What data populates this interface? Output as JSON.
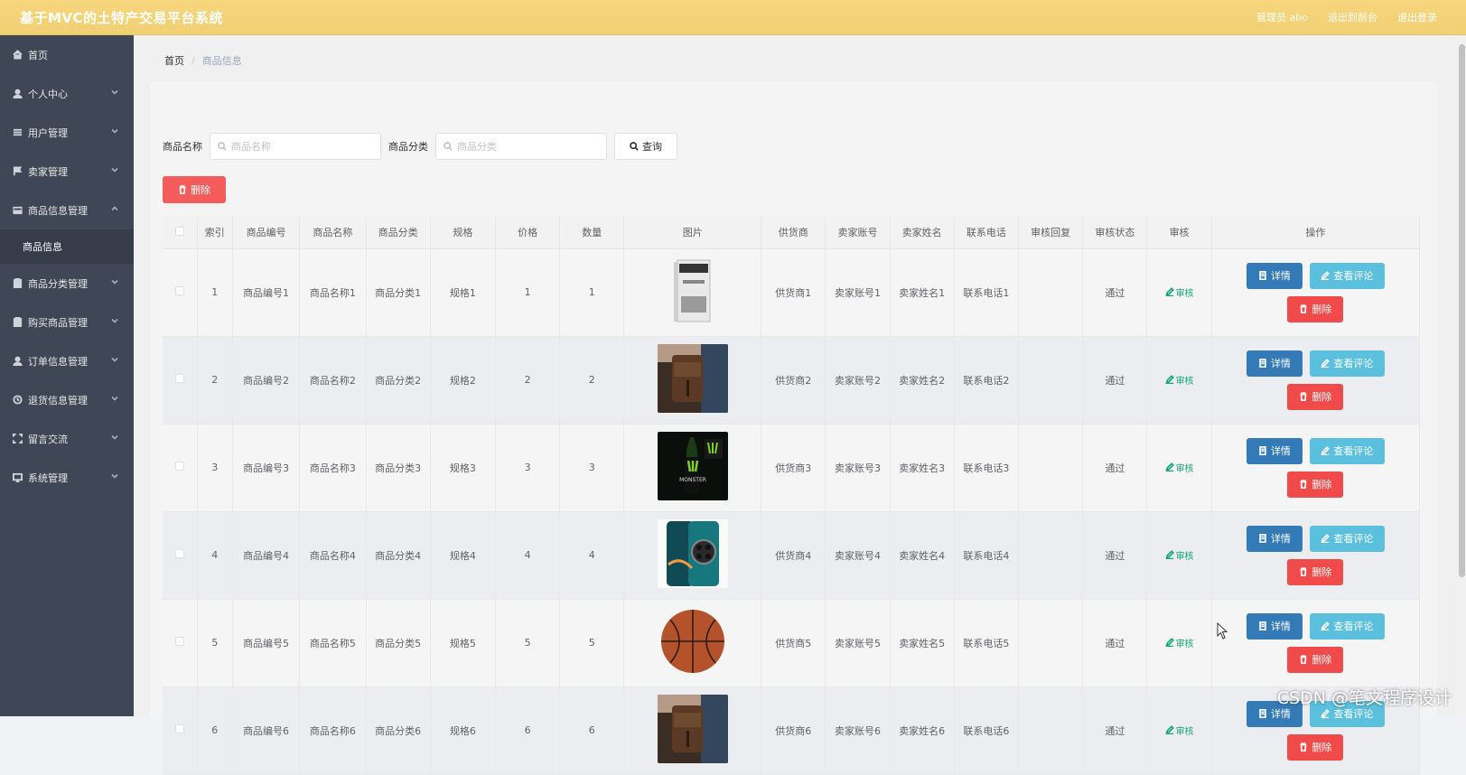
{
  "header": {
    "title": "基于MVC的土特产交易平台系统",
    "admin_label": "管理员 abo",
    "front_link": "退出到前台",
    "logout_link": "退出登录"
  },
  "sidebar": {
    "items": [
      {
        "label": "首页",
        "icon": "home-icon",
        "expandable": false
      },
      {
        "label": "个人中心",
        "icon": "user-icon",
        "expandable": true
      },
      {
        "label": "用户管理",
        "icon": "sliders-icon",
        "expandable": true
      },
      {
        "label": "卖家管理",
        "icon": "flag-icon",
        "expandable": true
      },
      {
        "label": "商品信息管理",
        "icon": "box-icon",
        "expandable": true,
        "expanded": true,
        "children": [
          {
            "label": "商品信息"
          }
        ]
      },
      {
        "label": "商品分类管理",
        "icon": "clipboard-icon",
        "expandable": true
      },
      {
        "label": "购买商品管理",
        "icon": "clipboard-icon",
        "expandable": true
      },
      {
        "label": "订单信息管理",
        "icon": "user-icon",
        "expandable": true
      },
      {
        "label": "退货信息管理",
        "icon": "clock-icon",
        "expandable": true
      },
      {
        "label": "留言交流",
        "icon": "expand-icon",
        "expandable": true
      },
      {
        "label": "系统管理",
        "icon": "monitor-icon",
        "expandable": true
      }
    ]
  },
  "breadcrumb": {
    "home": "首页",
    "current": "商品信息"
  },
  "search": {
    "name_label": "商品名称",
    "name_placeholder": "商品名称",
    "category_label": "商品分类",
    "category_placeholder": "商品分类",
    "query_button": "查询"
  },
  "delete_button": "删除",
  "table": {
    "headers": [
      "索引",
      "商品编号",
      "商品名称",
      "商品分类",
      "规格",
      "价格",
      "数量",
      "图片",
      "供货商",
      "卖家账号",
      "卖家姓名",
      "联系电话",
      "审核回复",
      "审核状态",
      "审核",
      "操作"
    ],
    "rows": [
      {
        "index": "1",
        "code": "商品编号1",
        "name": "商品名称1",
        "category": "商品分类1",
        "spec": "规格1",
        "price": "1",
        "qty": "1",
        "image": "book",
        "supplier": "供货商1",
        "seller_account": "卖家账号1",
        "seller_name": "卖家姓名1",
        "phone": "联系电话1",
        "reply": "",
        "status": "通过",
        "audit": "审核"
      },
      {
        "index": "2",
        "code": "商品编号2",
        "name": "商品名称2",
        "category": "商品分类2",
        "spec": "规格2",
        "price": "2",
        "qty": "2",
        "image": "bag",
        "supplier": "供货商2",
        "seller_account": "卖家账号2",
        "seller_name": "卖家姓名2",
        "phone": "联系电话2",
        "reply": "",
        "status": "通过",
        "audit": "审核"
      },
      {
        "index": "3",
        "code": "商品编号3",
        "name": "商品名称3",
        "category": "商品分类3",
        "spec": "规格3",
        "price": "3",
        "qty": "3",
        "image": "monster",
        "supplier": "供货商3",
        "seller_account": "卖家账号3",
        "seller_name": "卖家姓名3",
        "phone": "联系电话3",
        "reply": "",
        "status": "通过",
        "audit": "审核"
      },
      {
        "index": "4",
        "code": "商品编号4",
        "name": "商品名称4",
        "category": "商品分类4",
        "spec": "规格4",
        "price": "4",
        "qty": "4",
        "image": "phone",
        "supplier": "供货商4",
        "seller_account": "卖家账号4",
        "seller_name": "卖家姓名4",
        "phone": "联系电话4",
        "reply": "",
        "status": "通过",
        "audit": "审核"
      },
      {
        "index": "5",
        "code": "商品编号5",
        "name": "商品名称5",
        "category": "商品分类5",
        "spec": "规格5",
        "price": "5",
        "qty": "5",
        "image": "basketball",
        "supplier": "供货商5",
        "seller_account": "卖家账号5",
        "seller_name": "卖家姓名5",
        "phone": "联系电话5",
        "reply": "",
        "status": "通过",
        "audit": "审核"
      },
      {
        "index": "6",
        "code": "商品编号6",
        "name": "商品名称6",
        "category": "商品分类6",
        "spec": "规格6",
        "price": "6",
        "qty": "6",
        "image": "bag",
        "supplier": "供货商6",
        "seller_account": "卖家账号6",
        "seller_name": "卖家姓名6",
        "phone": "联系电话6",
        "reply": "",
        "status": "通过",
        "audit": "审核"
      }
    ],
    "ops": {
      "detail": "详情",
      "review": "查看评论",
      "delete": "删除"
    }
  },
  "watermark": "CSDN @笔文程序设计",
  "colors": {
    "topbar": "#f3d073",
    "sidebar": "#3f4655",
    "danger": "#f45c5c",
    "primary": "#337ab7",
    "info": "#5bc0de",
    "success": "#13a873"
  }
}
